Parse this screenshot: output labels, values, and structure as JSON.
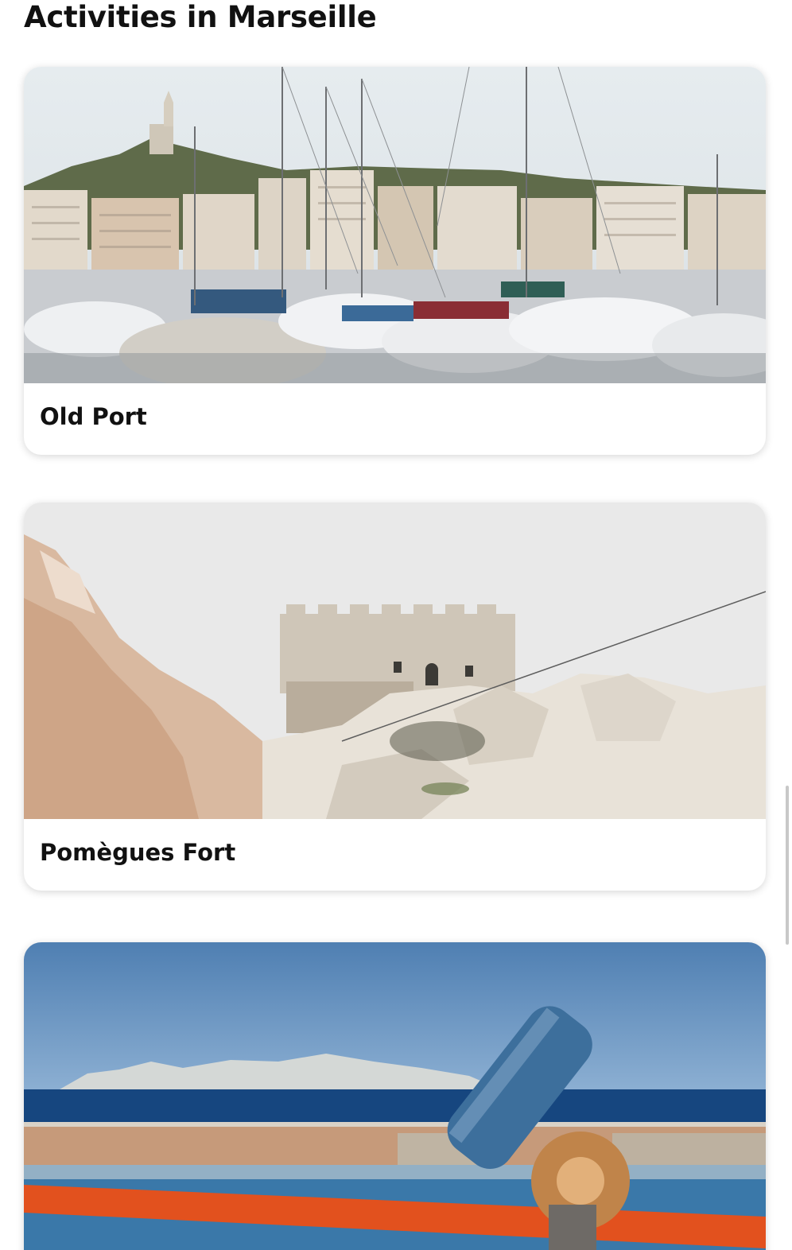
{
  "page": {
    "title": "Activities in Marseille"
  },
  "cards": [
    {
      "title": "Old Port",
      "image": "harbor-with-sailboats-photo"
    },
    {
      "title": "Pomègues Fort",
      "image": "stone-fort-on-rocks-photo"
    },
    {
      "title": "",
      "image": "sea-view-with-telescope-photo"
    }
  ],
  "colors": {
    "background": "#ffffff",
    "text": "#111111",
    "card_shadow": "#d0d0d0"
  }
}
